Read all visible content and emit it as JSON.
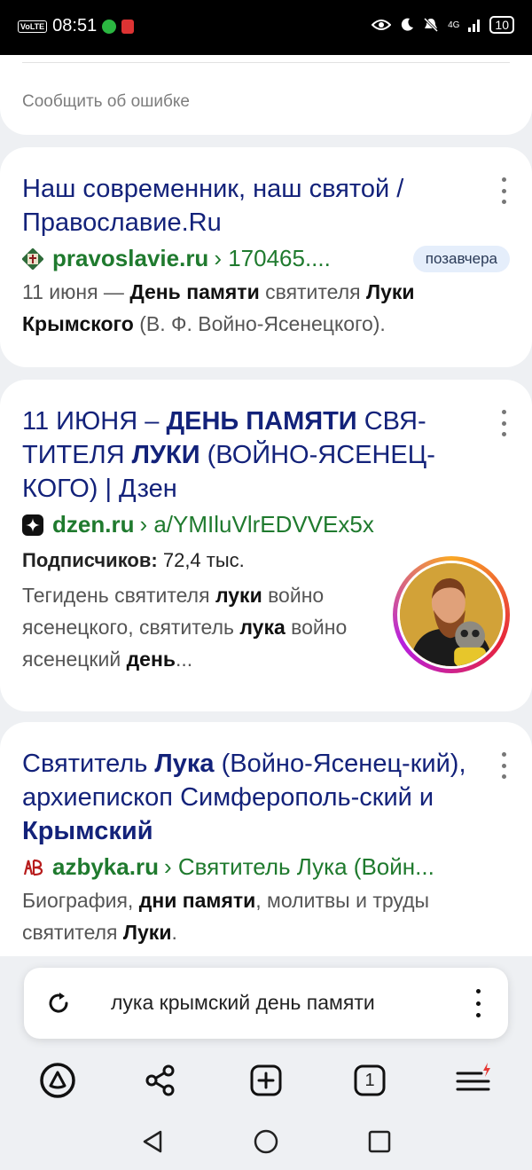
{
  "status_bar": {
    "volte": "VoLTE",
    "time": "08:51",
    "network": "4G",
    "battery": "10",
    "icons": [
      "whatsapp-icon",
      "notification-icon",
      "eye-icon",
      "moon-icon",
      "mute-icon",
      "signal-icon",
      "battery-icon"
    ]
  },
  "prev_card": {
    "report_error": "Сообщить об ошибке"
  },
  "results": [
    {
      "title": "Наш современник, наш святой / Православие.Ru",
      "domain": "pravoslavie.ru",
      "path": "› 170465....",
      "badge": "позавчера",
      "snippet": [
        {
          "t": "11 июня — ",
          "b": false
        },
        {
          "t": "День памяти",
          "b": true
        },
        {
          "t": " святителя ",
          "b": false
        },
        {
          "t": "Луки",
          "b": true
        },
        {
          "t": " ",
          "b": false
        },
        {
          "t": "Крымского",
          "b": true
        },
        {
          "t": " (В. Ф. Войно-Ясенецкого).",
          "b": false
        }
      ]
    },
    {
      "title": "11 ИЮНЯ – ДЕНЬ ПАМЯТИ СВЯ-ТИТЕЛЯ ЛУКИ (ВОЙНО-ЯСЕНЕЦ-КОГО) | Дзен",
      "title_parts": [
        {
          "t": "11 ИЮНЯ – ",
          "b": false
        },
        {
          "t": "ДЕНЬ ПАМЯТИ",
          "b": true
        },
        {
          "t": " СВЯ-ТИТЕЛЯ ",
          "b": false
        },
        {
          "t": "ЛУКИ",
          "b": true
        },
        {
          "t": " (ВОЙНО-ЯСЕНЕЦ-КОГО) | Дзен",
          "b": false
        }
      ],
      "domain": "dzen.ru",
      "path": "› a/YMIluVlrEDVVEx5x",
      "subscribers_label": "Подписчиков:",
      "subscribers_value": "72,4 тыс.",
      "snippet": [
        {
          "t": "Тегидень святителя ",
          "b": false
        },
        {
          "t": "луки",
          "b": true
        },
        {
          "t": " войно ясенецкого, святитель ",
          "b": false
        },
        {
          "t": "лука",
          "b": true
        },
        {
          "t": " войно ясенецкий ",
          "b": false
        },
        {
          "t": "день",
          "b": true
        },
        {
          "t": "...",
          "b": false
        }
      ]
    },
    {
      "title": "Святитель Лука (Войно-Ясенец-кий), архиепископ Симферополь-ский и Крымский",
      "title_parts": [
        {
          "t": "Святитель ",
          "b": false
        },
        {
          "t": "Лука",
          "b": true
        },
        {
          "t": " (Войно-Ясенец-кий), архиепископ Симферополь-ский и ",
          "b": false
        },
        {
          "t": "Крымский",
          "b": true
        }
      ],
      "domain": "azbyka.ru",
      "path": "› Святитель Лука (Войн...",
      "snippet": [
        {
          "t": "Биография, ",
          "b": false
        },
        {
          "t": "дни памяти",
          "b": true
        },
        {
          "t": ", молитвы и труды святителя ",
          "b": false
        },
        {
          "t": "Луки",
          "b": true
        },
        {
          "t": ".",
          "b": false
        }
      ]
    }
  ],
  "search_bar": {
    "query": "лука крымский день памяти"
  },
  "toolbar": {
    "tabs_count": "1"
  },
  "colors": {
    "title": "#13227a",
    "url": "#1f7a2e",
    "badge_bg": "#e5eefb",
    "alert": "#e53935"
  }
}
